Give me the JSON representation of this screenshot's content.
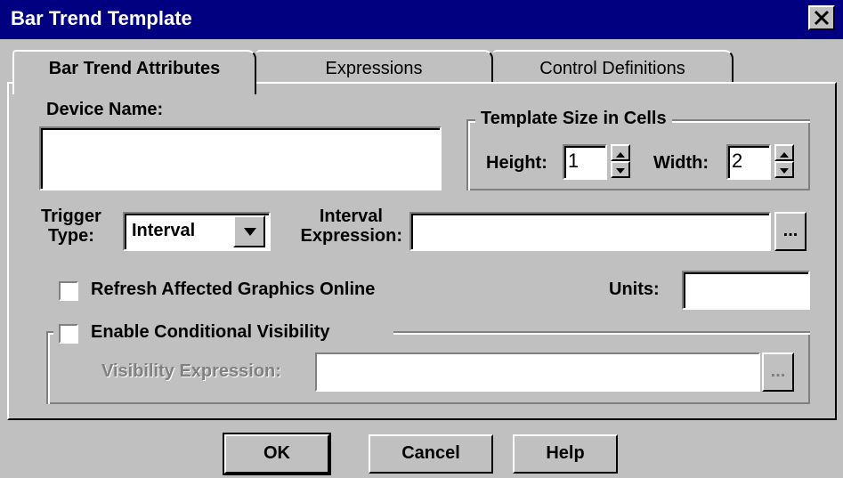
{
  "window": {
    "title": "Bar Trend Template"
  },
  "tabs": [
    {
      "label": "Bar Trend Attributes",
      "active": true
    },
    {
      "label": "Expressions",
      "active": false
    },
    {
      "label": "Control Definitions",
      "active": false
    }
  ],
  "device": {
    "label": "Device Name:",
    "value": ""
  },
  "template_size": {
    "group_label": "Template Size in Cells",
    "height_label": "Height:",
    "height_value": "1",
    "width_label": "Width:",
    "width_value": "2"
  },
  "trigger": {
    "label_line1": "Trigger",
    "label_line2": "Type:",
    "selected": "Interval"
  },
  "interval": {
    "label_line1": "Interval",
    "label_line2": "Expression:",
    "value": "",
    "browse_label": "..."
  },
  "refresh": {
    "label": "Refresh Affected Graphics Online",
    "checked": false
  },
  "units": {
    "label": "Units:",
    "value": ""
  },
  "visibility": {
    "label": "Enable Conditional Visibility",
    "checked": false,
    "expr_label": "Visibility Expression:",
    "expr_value": "",
    "browse_label": "..."
  },
  "buttons": {
    "ok": "OK",
    "cancel": "Cancel",
    "help": "Help"
  }
}
